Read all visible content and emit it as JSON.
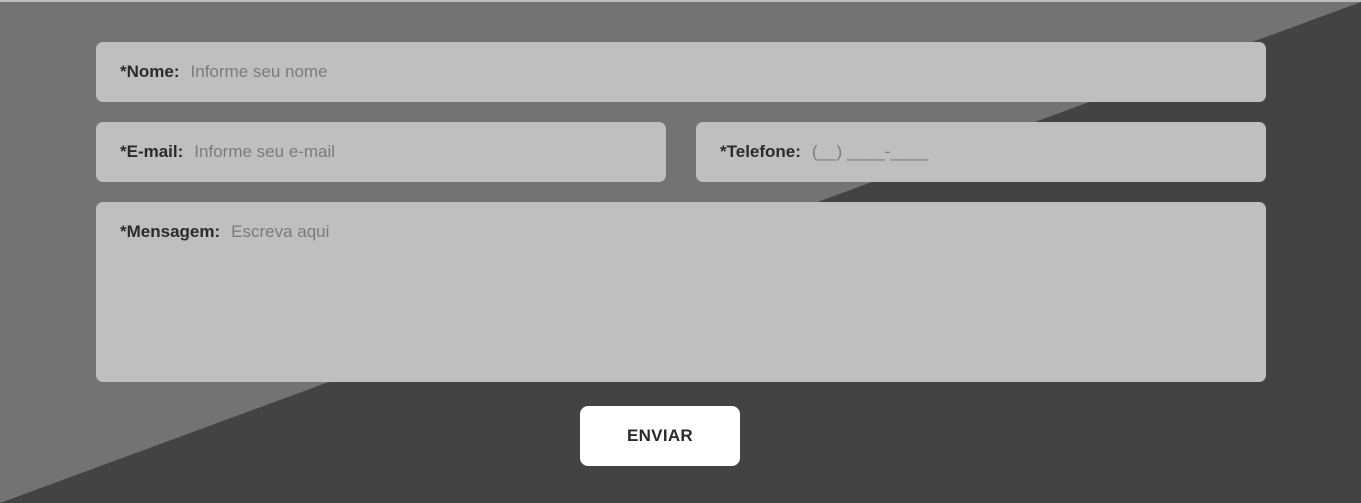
{
  "colors": {
    "background_light": "#737373",
    "background_dark": "#434343",
    "field_background": "#bfbfbf",
    "button_background": "#ffffff",
    "label_color": "#2b2b2b",
    "placeholder_color": "#7b7b7b"
  },
  "form": {
    "name": {
      "label": "*Nome:",
      "placeholder": "Informe seu nome",
      "value": ""
    },
    "email": {
      "label": "*E-mail:",
      "placeholder": "Informe seu e-mail",
      "value": ""
    },
    "phone": {
      "label": "*Telefone:",
      "placeholder": "(__) ____-____",
      "value": ""
    },
    "message": {
      "label": "*Mensagem:",
      "placeholder": "Escreva aqui",
      "value": ""
    },
    "submit_label": "ENVIAR"
  }
}
